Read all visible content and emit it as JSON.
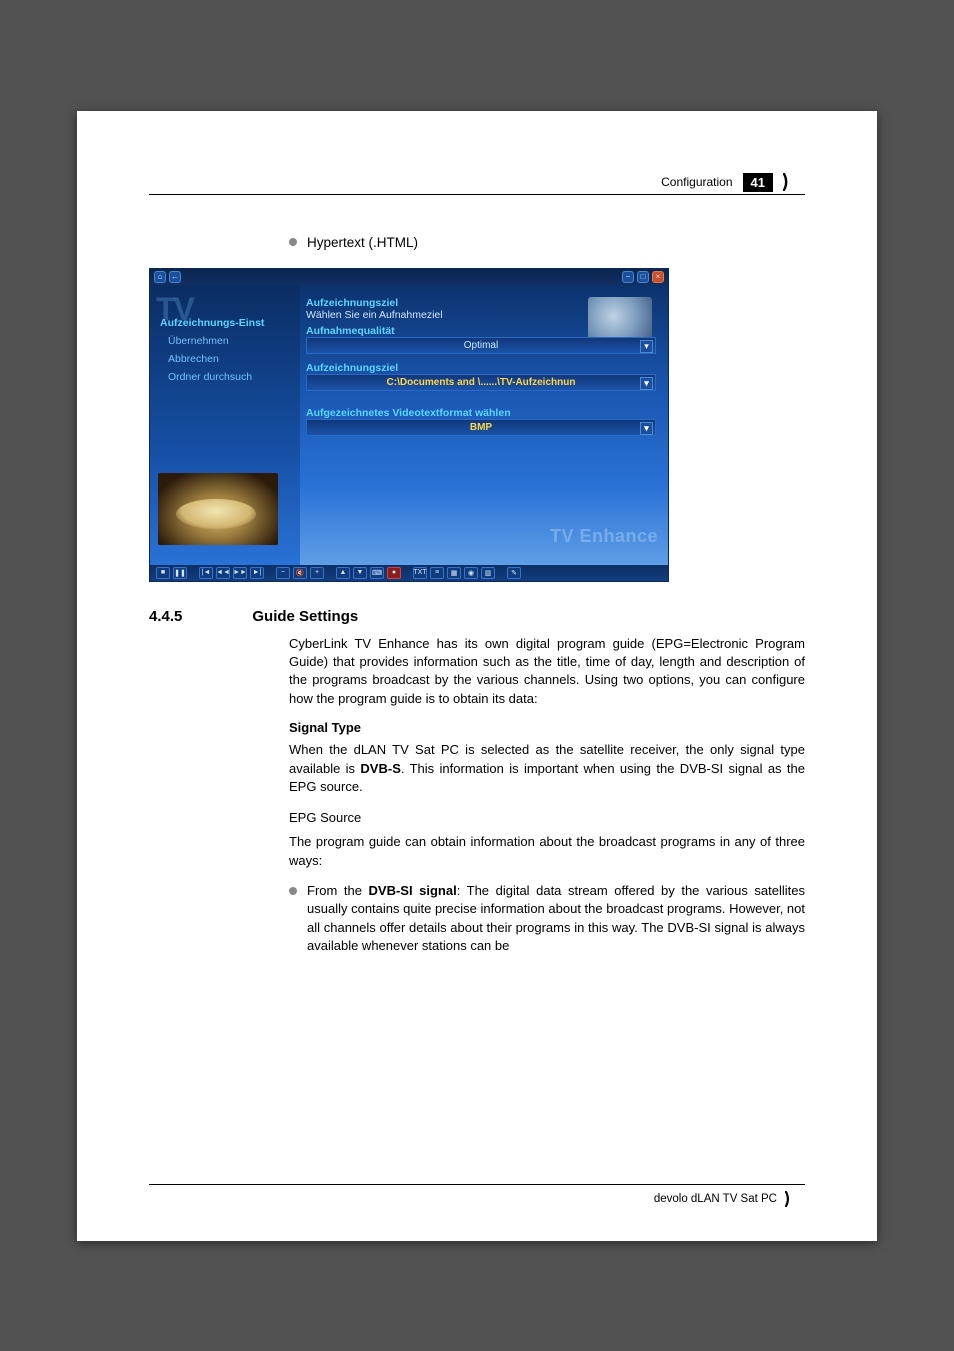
{
  "header": {
    "section_name": "Configuration",
    "page_number": "41"
  },
  "top_bullet": "Hypertext (.HTML)",
  "screenshot": {
    "watermark": "TV",
    "left_menu": {
      "header": "Aufzeichnungs-Einst",
      "items": [
        "Übernehmen",
        "Abbrechen",
        "Ordner durchsuch"
      ]
    },
    "groups": {
      "rec_target_label": "Aufzeichnungsziel",
      "rec_target_sub": "Wählen Sie ein Aufnahmeziel",
      "quality_label": "Aufnahmequalität",
      "quality_value": "Optimal",
      "path_label": "Aufzeichnungsziel",
      "path_value": "C:\\Documents and \\......\\TV-Aufzeichnun",
      "teletext_label": "Aufgezeichnetes Videotextformat wählen",
      "teletext_value": "BMP"
    },
    "brand": "TV Enhance"
  },
  "section": {
    "number": "4.4.5",
    "title": "Guide Settings",
    "intro": "CyberLink TV Enhance has its own digital program guide (EPG=Electronic Program Guide) that provides information such as the title, time of day, length and description of the programs broadcast by the various channels. Using two options, you can configure how the program guide is to obtain its data:",
    "signal_type_heading": "Signal Type",
    "signal_type_text_pre": "When the dLAN TV Sat PC is selected as the satellite receiver, the only signal type available is ",
    "signal_type_bold": "DVB-S",
    "signal_type_text_post": ". This information is important when using the DVB-SI signal as the EPG source.",
    "epg_source_heading": "EPG Source",
    "epg_source_intro": "The program guide can obtain information about the broadcast programs in any of three ways:",
    "bullet_prefix": "From the ",
    "bullet_bold": "DVB-SI signal",
    "bullet_rest": ": The digital data stream offered by the various satellites usually contains quite precise information about the broadcast programs. However, not all channels offer details about their programs in this way. The DVB-SI signal is always available whenever stations can be"
  },
  "footer": {
    "product": "devolo dLAN TV Sat PC"
  }
}
